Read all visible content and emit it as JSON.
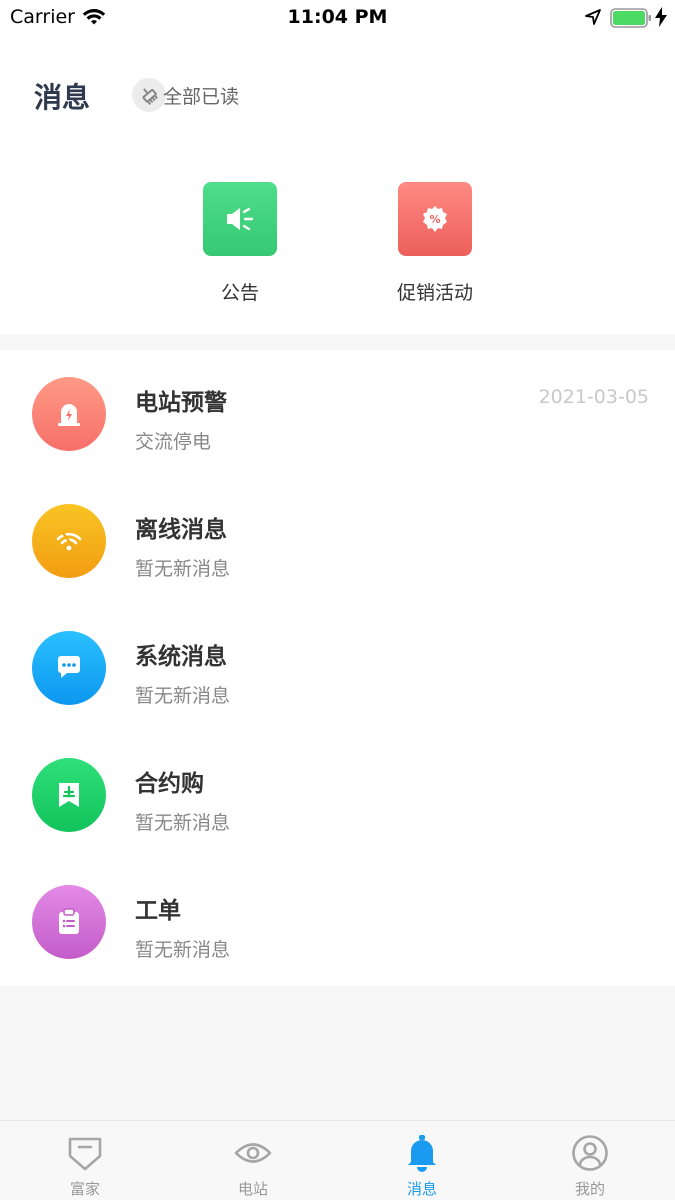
{
  "status_bar": {
    "carrier": "Carrier",
    "time": "11:04 PM",
    "icons": [
      "wifi-icon",
      "location-arrow-icon",
      "battery-icon",
      "charging-bolt-icon"
    ]
  },
  "header": {
    "title": "消息",
    "read_all_label": "全部已读",
    "read_all_icon": "broom-icon"
  },
  "quick_actions": [
    {
      "label": "公告",
      "icon": "megaphone-icon",
      "color": "#3fd27c"
    },
    {
      "label": "促销活动",
      "icon": "discount-badge-icon",
      "color": "#f26b66"
    }
  ],
  "messages": [
    {
      "title": "电站预警",
      "subtitle": "交流停电",
      "date": "2021-03-05",
      "icon": "alarm-lamp-icon",
      "color": "#ff7f70"
    },
    {
      "title": "离线消息",
      "subtitle": "暂无新消息",
      "date": "",
      "icon": "wifi-off-icon",
      "color": "#f5b21a"
    },
    {
      "title": "系统消息",
      "subtitle": "暂无新消息",
      "date": "",
      "icon": "chat-bubble-icon",
      "color": "#16a8f5"
    },
    {
      "title": "合约购",
      "subtitle": "暂无新消息",
      "date": "",
      "icon": "contract-bookmark-icon",
      "color": "#1fd46a"
    },
    {
      "title": "工单",
      "subtitle": "暂无新消息",
      "date": "",
      "icon": "clipboard-icon",
      "color": "#d26bd6"
    }
  ],
  "tabs": [
    {
      "label": "富家",
      "icon": "diamond-shield-icon",
      "active": false
    },
    {
      "label": "电站",
      "icon": "eye-icon",
      "active": false
    },
    {
      "label": "消息",
      "icon": "bell-icon",
      "active": true
    },
    {
      "label": "我的",
      "icon": "user-circle-icon",
      "active": false
    }
  ],
  "colors": {
    "accent": "#1a9bf0",
    "title": "#2f3a4f",
    "background": "#f7f7f7"
  }
}
